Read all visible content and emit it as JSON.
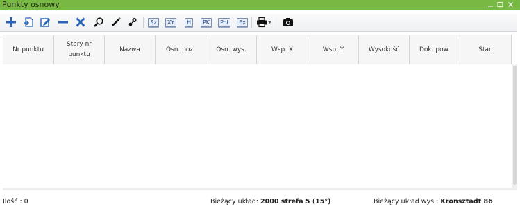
{
  "window": {
    "title": "Punkty osnowy"
  },
  "toolbar": {
    "badges": [
      "Sz",
      "XY",
      "H",
      "PK",
      "Poł",
      "Ex"
    ]
  },
  "icons": {
    "add": "plus-icon",
    "import": "import-icon",
    "edit": "edit-icon",
    "remove": "minus-icon",
    "delete": "x-icon",
    "search": "magnifier-icon",
    "pencil": "pencil-icon",
    "keys": "keys-icon",
    "print": "printer-icon",
    "camera": "camera-icon"
  },
  "colors": {
    "titlebar": "#78b943",
    "icon_blue": "#2a64b8"
  },
  "table": {
    "columns": [
      "Nr punktu",
      "Stary nr\npunktu",
      "Nazwa",
      "Osn. poz.",
      "Osn. wys.",
      "Wsp. X",
      "Wsp. Y",
      "Wysokość",
      "Dok. pow.",
      "Stan"
    ],
    "rows": []
  },
  "footer": {
    "count_label": "Ilość : 0",
    "system_label": "Bieżący układ:",
    "system_value": "2000 strefa 5 (15°)",
    "height_label": "Bieżący układ wys.:",
    "height_value": "Kronsztadt 86"
  }
}
